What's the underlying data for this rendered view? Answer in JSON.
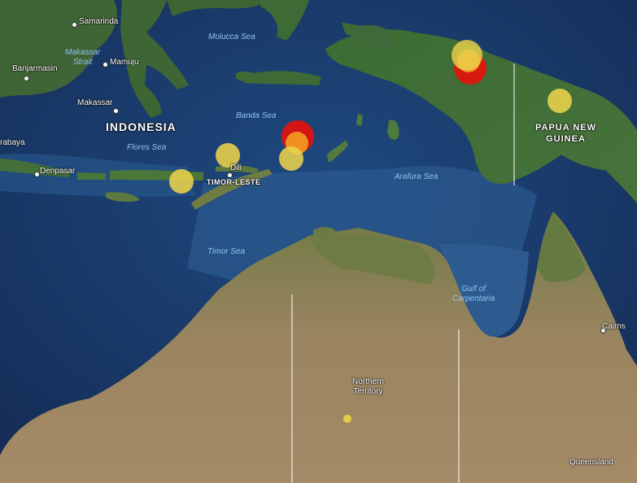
{
  "seas": {
    "molucca": "Molucca Sea",
    "banda": "Banda Sea",
    "flores": "Flores Sea",
    "arafura": "Arafura Sea",
    "timor": "Timor Sea",
    "makassar_line1": "Makassar",
    "makassar_line2": "Strait",
    "carpentaria_line1": "Gulf of",
    "carpentaria_line2": "Carpentaria"
  },
  "countries": {
    "indonesia": "INDONESIA",
    "timor_leste": "TIMOR-LESTE",
    "png_line1": "PAPUA NEW",
    "png_line2": "GUINEA"
  },
  "cities": {
    "samarinda": "Samarinda",
    "mamuju": "Mamuju",
    "banjarmasin": "Banjarmasin",
    "makassar": "Makassar",
    "surabaya": "rabaya",
    "denpasar": "Denpasar",
    "dili": "Dili",
    "cairns": "Cairns"
  },
  "regions": {
    "northern_territory_line1": "Northern",
    "northern_territory_line2": "Territory",
    "queensland": "Queensland"
  },
  "colors": {
    "ocean_deep": "#17305e",
    "ocean_shallow": "#2e5a8c",
    "land_green": "#3f6a34",
    "land_arid": "#8c7a56",
    "quake_red": "#e3120b",
    "quake_orange": "#f5a623",
    "quake_yellow": "#ead24b"
  },
  "earthquakes": [
    {
      "name": "quake-banda-red",
      "color": "red"
    },
    {
      "name": "quake-banda-orange",
      "color": "orange"
    },
    {
      "name": "quake-banda-yellow",
      "color": "yellow"
    },
    {
      "name": "quake-wetar",
      "color": "yellow"
    },
    {
      "name": "quake-timor-west",
      "color": "yellow"
    },
    {
      "name": "quake-papua-red",
      "color": "red"
    },
    {
      "name": "quake-papua-orange",
      "color": "orange"
    },
    {
      "name": "quake-papua-yellow",
      "color": "yellow"
    },
    {
      "name": "quake-png",
      "color": "yellow"
    },
    {
      "name": "quake-northern-territory",
      "color": "yellow"
    }
  ]
}
